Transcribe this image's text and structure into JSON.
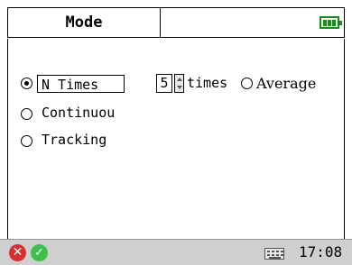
{
  "title": "Mode",
  "options": [
    {
      "label": "N Times",
      "checked": true
    },
    {
      "label": "Continuou",
      "checked": false
    },
    {
      "label": "Tracking",
      "checked": false
    }
  ],
  "ntimes": {
    "value": "5",
    "unit": "times"
  },
  "average": {
    "label": "Average",
    "checked": false
  },
  "statusbar": {
    "time": "17:08"
  },
  "icons": {
    "battery": "battery-icon",
    "cancel": "cancel-icon",
    "ok": "ok-icon",
    "keyboard": "keyboard-icon"
  },
  "colors": {
    "battery": "#1a8c1a",
    "cancel": "#d83030",
    "ok": "#3cc24a"
  }
}
